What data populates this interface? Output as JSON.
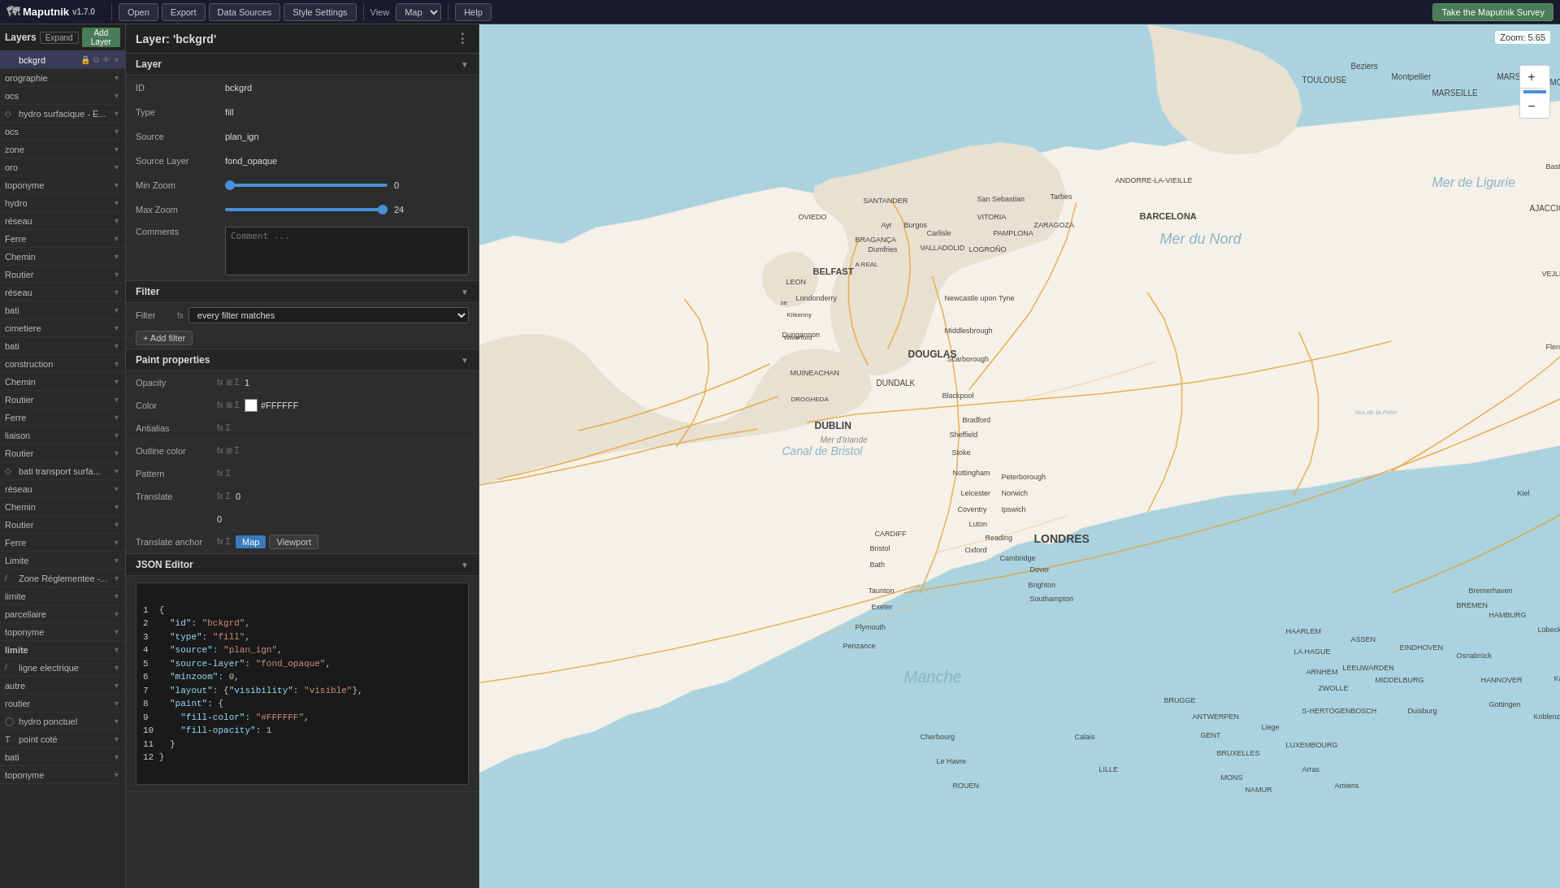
{
  "app": {
    "name": "Maputnik",
    "version": "v1.7.0",
    "zoom_level": "Zoom: 5.65"
  },
  "topnav": {
    "open_label": "Open",
    "export_label": "Export",
    "datasources_label": "Data Sources",
    "style_settings_label": "Style Settings",
    "view_label": "View",
    "view_option": "Map",
    "help_label": "Help",
    "survey_label": "Take the Maputnik Survey"
  },
  "layers_panel": {
    "title": "Layers",
    "expand_label": "Expand",
    "add_label": "Add Layer",
    "items": [
      {
        "name": "bckgrd",
        "icon": "",
        "type": "fill",
        "selected": true
      },
      {
        "name": "orographie",
        "icon": "",
        "type": "fill"
      },
      {
        "name": "ocs",
        "icon": "",
        "type": "fill"
      },
      {
        "name": "hydro surfacique - E...",
        "icon": "◇",
        "type": "fill"
      },
      {
        "name": "ocs",
        "icon": "",
        "type": "fill"
      },
      {
        "name": "zone",
        "icon": "",
        "type": "fill"
      },
      {
        "name": "oro",
        "icon": "",
        "type": "fill"
      },
      {
        "name": "toponyme",
        "icon": "",
        "type": "symbol"
      },
      {
        "name": "hydro",
        "icon": "",
        "type": "fill"
      },
      {
        "name": "réseau",
        "icon": "",
        "type": "line"
      },
      {
        "name": "Ferre",
        "icon": "",
        "type": "line"
      },
      {
        "name": "Chemin",
        "icon": "",
        "type": "line"
      },
      {
        "name": "Routier",
        "icon": "",
        "type": "line"
      },
      {
        "name": "réseau",
        "icon": "",
        "type": "line"
      },
      {
        "name": "bati",
        "icon": "",
        "type": "fill"
      },
      {
        "name": "cimetiere",
        "icon": "",
        "type": "fill"
      },
      {
        "name": "bati",
        "icon": "",
        "type": "fill"
      },
      {
        "name": "construction",
        "icon": "",
        "type": "fill"
      },
      {
        "name": "Chemin",
        "icon": "",
        "type": "line"
      },
      {
        "name": "Routier",
        "icon": "",
        "type": "line"
      },
      {
        "name": "Ferre",
        "icon": "",
        "type": "line"
      },
      {
        "name": "liaison",
        "icon": "",
        "type": "line"
      },
      {
        "name": "Routier",
        "icon": "",
        "type": "line"
      },
      {
        "name": "bati transport surfa...",
        "icon": "◇",
        "type": "fill"
      },
      {
        "name": "réseau",
        "icon": "",
        "type": "line"
      },
      {
        "name": "Chemin",
        "icon": "",
        "type": "line"
      },
      {
        "name": "Routier",
        "icon": "",
        "type": "line"
      },
      {
        "name": "Ferre",
        "icon": "",
        "type": "line"
      },
      {
        "name": "Limite",
        "icon": "",
        "type": "line"
      },
      {
        "name": "Zone Réglementee -...",
        "icon": "/",
        "type": "fill"
      },
      {
        "name": "limite",
        "icon": "",
        "type": "line"
      },
      {
        "name": "parcellaire",
        "icon": "",
        "type": "line"
      },
      {
        "name": "toponyme",
        "icon": "",
        "type": "symbol"
      },
      {
        "name": "limite",
        "icon": "",
        "type": "line"
      },
      {
        "name": "ligne electrique",
        "icon": "/",
        "type": "line"
      },
      {
        "name": "autre",
        "icon": "",
        "type": "fill"
      },
      {
        "name": "routier",
        "icon": "",
        "type": "line"
      },
      {
        "name": "hydro ponctuel",
        "icon": "◯",
        "type": "symbol"
      },
      {
        "name": "point coté",
        "icon": "T",
        "type": "symbol"
      },
      {
        "name": "bati",
        "icon": "",
        "type": "fill"
      },
      {
        "name": "toponyme",
        "icon": "",
        "type": "symbol"
      }
    ]
  },
  "props_panel": {
    "header": "Layer: 'bckgrd'",
    "layer_section": {
      "title": "Layer",
      "id_label": "ID",
      "id_value": "bckgrd",
      "type_label": "Type",
      "type_value": "fill",
      "source_label": "Source",
      "source_value": "plan_ign",
      "source_layer_label": "Source Layer",
      "source_layer_value": "fond_opaque",
      "min_zoom_label": "Min Zoom",
      "min_zoom_value": "0",
      "min_zoom_slider": 0,
      "max_zoom_label": "Max Zoom",
      "max_zoom_value": "24",
      "max_zoom_slider": 100,
      "comments_label": "Comments",
      "comments_placeholder": "Comment ..."
    },
    "filter_section": {
      "title": "Filter",
      "filter_label": "Filter",
      "filter_value": "every filter matches",
      "add_filter_label": "+ Add filter"
    },
    "paint_section": {
      "title": "Paint properties",
      "opacity_label": "Opacity",
      "opacity_value": "1",
      "color_label": "Color",
      "color_value": "#FFFFFF",
      "color_swatch": "#FFFFFF",
      "antialias_label": "Antialias",
      "outline_color_label": "Outline color",
      "pattern_label": "Pattern",
      "translate_label": "Translate",
      "translate_x": "0",
      "translate_y": "0",
      "translate_anchor_label": "Translate anchor",
      "translate_anchor_map": "Map",
      "translate_anchor_viewport": "Viewport"
    },
    "json_editor": {
      "title": "JSON Editor",
      "content": "{\n  \"id\": \"bckgrd\",\n  \"type\": \"fill\",\n  \"source\": \"plan_ign\",\n  \"source-layer\": \"fond_opaque\",\n  \"minzoom\": 0,\n  \"layout\": {\"visibility\": \"visible\"},\n  \"paint\": {\n    \"fill-color\": \"#FFFFFF\",\n    \"fill-opacity\": 1\n  }\n}"
    }
  },
  "map": {
    "zoom_display": "Zoom: 5.65",
    "zoom_in_label": "+",
    "zoom_out_label": "−"
  }
}
